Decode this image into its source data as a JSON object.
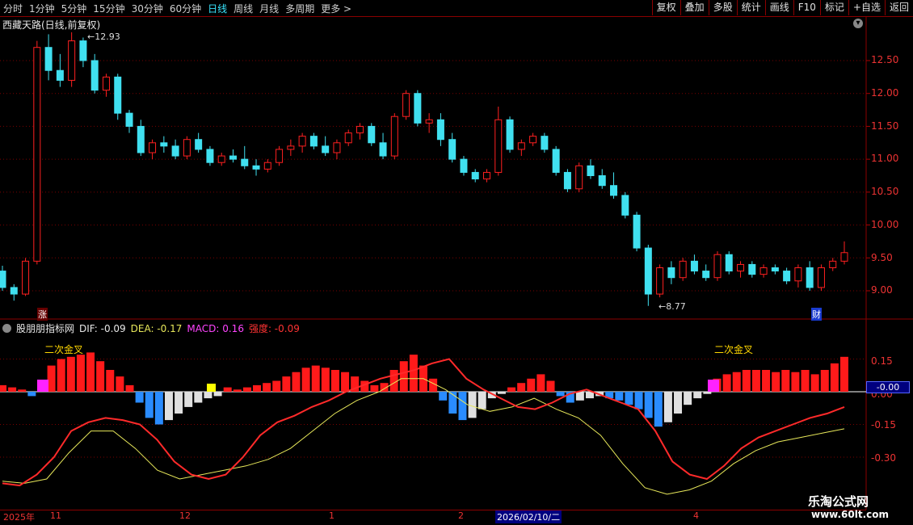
{
  "toolbar": {
    "periods": [
      "分时",
      "1分钟",
      "5分钟",
      "15分钟",
      "30分钟",
      "60分钟",
      "日线",
      "周线",
      "月线",
      "多周期",
      "更多 >"
    ],
    "active_period": "日线",
    "right_buttons": [
      "复权",
      "叠加",
      "多股",
      "统计",
      "画线",
      "F10",
      "标记",
      "+自选",
      "返回"
    ]
  },
  "stock": {
    "title": "西藏天路(日线,前复权)",
    "high_label": "12.93",
    "low_label": "8.77"
  },
  "price_axis": {
    "ticks": [
      "12.50",
      "12.00",
      "11.50",
      "11.00",
      "10.50",
      "10.00",
      "9.50",
      "9.00"
    ]
  },
  "indicator": {
    "name": "股朋朋指标网",
    "dif_label": "DIF: -0.09",
    "dea_label": "DEA: -0.17",
    "macd_label": "MACD: 0.16",
    "strength_label": "强度: -0.09",
    "axis": [
      "0.15",
      "0.00",
      "-0.15",
      "-0.30"
    ],
    "current_value": "-0.00",
    "annotations": [
      "二次金叉",
      "二次金叉"
    ]
  },
  "markers": {
    "zhang": "涨",
    "cai": "财"
  },
  "time_axis": {
    "labels": [
      "2025年",
      "11",
      "12",
      "1",
      "2",
      "2026/02/10/二",
      "4"
    ]
  },
  "watermark": {
    "site": "乐淘公式网",
    "url": "www.60lt.com"
  },
  "colors": {
    "up": "#ff2020",
    "down": "#40e0f0",
    "macd_pos": "#ff1a1a",
    "macd_neg": "#2a8cff",
    "macd_weak": "#e0e0e0",
    "dif": "#ff2a2a",
    "dea": "#e8e85a"
  },
  "chart_data": {
    "type": "candlestick",
    "price_candles": [
      [
        9.3,
        9.38,
        9.0,
        9.05
      ],
      [
        9.05,
        9.1,
        8.85,
        8.95
      ],
      [
        8.95,
        9.5,
        8.92,
        9.45
      ],
      [
        9.45,
        12.8,
        9.4,
        12.7
      ],
      [
        12.7,
        12.9,
        12.2,
        12.35
      ],
      [
        12.35,
        12.6,
        12.1,
        12.2
      ],
      [
        12.2,
        12.93,
        12.1,
        12.8
      ],
      [
        12.8,
        12.85,
        12.4,
        12.5
      ],
      [
        12.5,
        12.6,
        12.0,
        12.05
      ],
      [
        12.05,
        12.3,
        11.95,
        12.25
      ],
      [
        12.25,
        12.3,
        11.6,
        11.7
      ],
      [
        11.7,
        11.75,
        11.4,
        11.5
      ],
      [
        11.5,
        11.6,
        11.05,
        11.1
      ],
      [
        11.1,
        11.3,
        11.0,
        11.25
      ],
      [
        11.25,
        11.35,
        11.1,
        11.2
      ],
      [
        11.2,
        11.3,
        11.0,
        11.05
      ],
      [
        11.05,
        11.35,
        11.0,
        11.3
      ],
      [
        11.3,
        11.4,
        11.1,
        11.15
      ],
      [
        11.15,
        11.2,
        10.9,
        10.95
      ],
      [
        10.95,
        11.1,
        10.9,
        11.05
      ],
      [
        11.05,
        11.15,
        10.95,
        11.0
      ],
      [
        11.0,
        11.2,
        10.85,
        10.9
      ],
      [
        10.9,
        11.0,
        10.75,
        10.85
      ],
      [
        10.85,
        11.0,
        10.8,
        10.95
      ],
      [
        10.95,
        11.2,
        10.9,
        11.15
      ],
      [
        11.15,
        11.3,
        11.05,
        11.2
      ],
      [
        11.2,
        11.4,
        11.1,
        11.35
      ],
      [
        11.35,
        11.4,
        11.15,
        11.2
      ],
      [
        11.2,
        11.35,
        11.05,
        11.1
      ],
      [
        11.1,
        11.3,
        11.0,
        11.25
      ],
      [
        11.25,
        11.45,
        11.2,
        11.4
      ],
      [
        11.4,
        11.55,
        11.3,
        11.5
      ],
      [
        11.5,
        11.55,
        11.2,
        11.25
      ],
      [
        11.25,
        11.4,
        11.0,
        11.05
      ],
      [
        11.05,
        11.7,
        11.0,
        11.65
      ],
      [
        11.65,
        12.05,
        11.6,
        12.0
      ],
      [
        12.0,
        12.05,
        11.5,
        11.55
      ],
      [
        11.55,
        11.7,
        11.4,
        11.6
      ],
      [
        11.6,
        11.7,
        11.2,
        11.3
      ],
      [
        11.3,
        11.4,
        10.95,
        11.0
      ],
      [
        11.0,
        11.05,
        10.75,
        10.8
      ],
      [
        10.8,
        10.85,
        10.65,
        10.7
      ],
      [
        10.7,
        10.85,
        10.65,
        10.8
      ],
      [
        10.8,
        11.8,
        10.75,
        11.6
      ],
      [
        11.6,
        11.65,
        11.1,
        11.15
      ],
      [
        11.15,
        11.3,
        11.05,
        11.25
      ],
      [
        11.25,
        11.4,
        11.2,
        11.35
      ],
      [
        11.35,
        11.4,
        11.1,
        11.15
      ],
      [
        11.15,
        11.2,
        10.75,
        10.8
      ],
      [
        10.8,
        10.85,
        10.5,
        10.55
      ],
      [
        10.55,
        10.95,
        10.5,
        10.9
      ],
      [
        10.9,
        11.0,
        10.7,
        10.75
      ],
      [
        10.75,
        10.85,
        10.55,
        10.6
      ],
      [
        10.6,
        10.8,
        10.4,
        10.45
      ],
      [
        10.45,
        10.5,
        10.1,
        10.15
      ],
      [
        10.15,
        10.2,
        9.6,
        9.65
      ],
      [
        9.65,
        9.7,
        8.77,
        8.95
      ],
      [
        8.95,
        9.4,
        8.9,
        9.35
      ],
      [
        9.35,
        9.45,
        9.1,
        9.2
      ],
      [
        9.2,
        9.5,
        9.15,
        9.45
      ],
      [
        9.45,
        9.55,
        9.25,
        9.3
      ],
      [
        9.3,
        9.4,
        9.15,
        9.2
      ],
      [
        9.2,
        9.6,
        9.15,
        9.55
      ],
      [
        9.55,
        9.6,
        9.25,
        9.3
      ],
      [
        9.3,
        9.45,
        9.2,
        9.4
      ],
      [
        9.4,
        9.45,
        9.2,
        9.25
      ],
      [
        9.25,
        9.4,
        9.2,
        9.35
      ],
      [
        9.35,
        9.4,
        9.25,
        9.3
      ],
      [
        9.3,
        9.35,
        9.1,
        9.15
      ],
      [
        9.15,
        9.4,
        9.05,
        9.35
      ],
      [
        9.35,
        9.45,
        9.0,
        9.05
      ],
      [
        9.05,
        9.4,
        9.0,
        9.35
      ],
      [
        9.35,
        9.5,
        9.3,
        9.45
      ],
      [
        9.45,
        9.75,
        9.4,
        9.58
      ]
    ],
    "macd_bars": [
      0.03,
      0.02,
      0.01,
      -0.02,
      0.04,
      0.12,
      0.15,
      0.16,
      0.17,
      0.18,
      0.14,
      0.1,
      0.07,
      0.03,
      -0.05,
      -0.12,
      -0.15,
      -0.13,
      -0.1,
      -0.07,
      -0.05,
      -0.03,
      -0.02,
      0.02,
      0.01,
      0.02,
      0.03,
      0.04,
      0.05,
      0.07,
      0.09,
      0.11,
      0.12,
      0.11,
      0.1,
      0.09,
      0.07,
      0.05,
      0.03,
      0.04,
      0.1,
      0.14,
      0.17,
      0.12,
      0.06,
      -0.04,
      -0.1,
      -0.13,
      -0.12,
      -0.08,
      -0.03,
      -0.01,
      0.02,
      0.04,
      0.06,
      0.08,
      0.05,
      -0.02,
      -0.05,
      -0.04,
      -0.03,
      -0.02,
      -0.03,
      -0.04,
      -0.06,
      -0.08,
      -0.12,
      -0.16,
      -0.14,
      -0.1,
      -0.06,
      -0.03,
      -0.01,
      0.06,
      0.08,
      0.09,
      0.1,
      0.1,
      0.1,
      0.09,
      0.1,
      0.09,
      0.1,
      0.08,
      0.1,
      0.13,
      0.16
    ],
    "dif": [
      -0.42,
      -0.43,
      -0.38,
      -0.3,
      -0.18,
      -0.14,
      -0.12,
      -0.13,
      -0.15,
      -0.22,
      -0.32,
      -0.38,
      -0.4,
      -0.38,
      -0.3,
      -0.2,
      -0.14,
      -0.11,
      -0.07,
      -0.04,
      0.0,
      0.03,
      0.06,
      0.08,
      0.1,
      0.13,
      0.15,
      0.06,
      0.01,
      -0.03,
      -0.07,
      -0.08,
      -0.05,
      -0.01,
      0.01,
      -0.02,
      -0.05,
      -0.08,
      -0.18,
      -0.32,
      -0.38,
      -0.4,
      -0.34,
      -0.26,
      -0.21,
      -0.18,
      -0.15,
      -0.12,
      -0.1,
      -0.07
    ],
    "dea": [
      -0.41,
      -0.42,
      -0.4,
      -0.28,
      -0.18,
      -0.18,
      -0.26,
      -0.36,
      -0.4,
      -0.38,
      -0.36,
      -0.34,
      -0.31,
      -0.26,
      -0.18,
      -0.1,
      -0.04,
      0.0,
      0.06,
      0.06,
      0.01,
      -0.06,
      -0.09,
      -0.07,
      -0.03,
      -0.08,
      -0.12,
      -0.2,
      -0.33,
      -0.44,
      -0.47,
      -0.45,
      -0.41,
      -0.33,
      -0.27,
      -0.23,
      -0.21,
      -0.19,
      -0.17
    ]
  }
}
